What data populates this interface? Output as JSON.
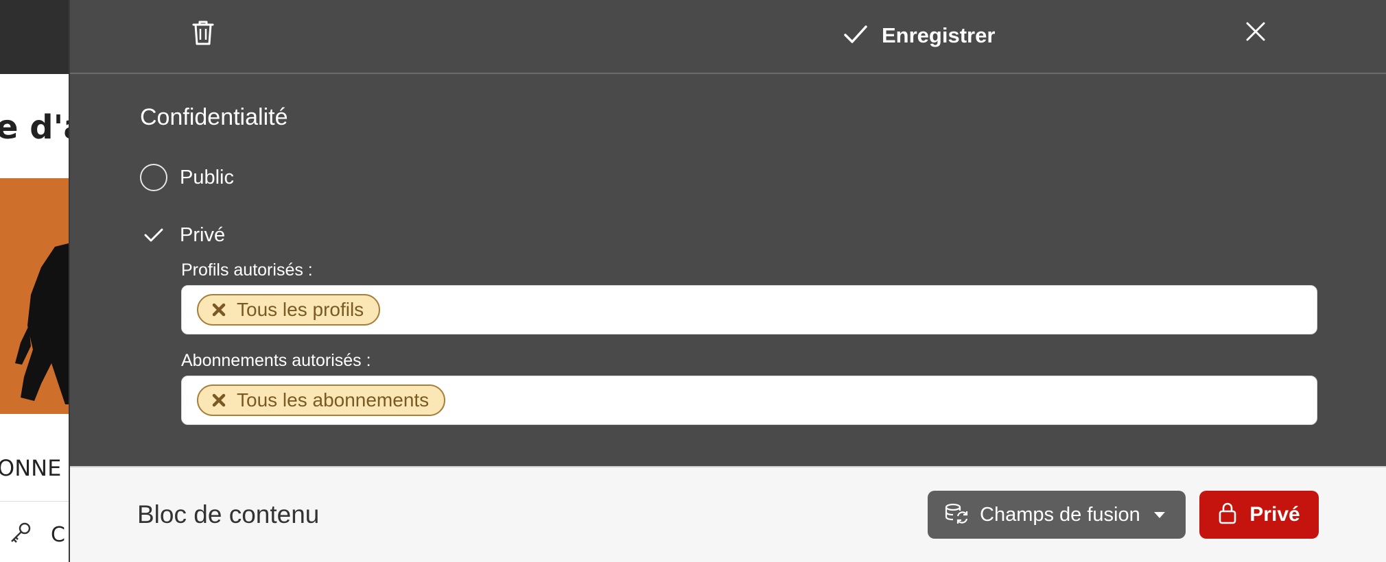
{
  "background": {
    "title_fragment": "e d'a",
    "caption_fragment": "ONNE",
    "menu_fragment": "C"
  },
  "toolbar": {
    "save_label": "Enregistrer"
  },
  "privacy": {
    "title": "Confidentialité",
    "options": [
      {
        "label": "Public",
        "selected": false
      },
      {
        "label": "Privé",
        "selected": true
      }
    ],
    "profiles_label": "Profils autorisés :",
    "profiles_tags": [
      "Tous les profils"
    ],
    "subscriptions_label": "Abonnements autorisés :",
    "subscriptions_tags": [
      "Tous les abonnements"
    ]
  },
  "bottom": {
    "block_title": "Bloc de contenu",
    "fusion_label": "Champs de fusion",
    "privacy_button_label": "Privé"
  },
  "colors": {
    "editor_bg": "#4a4a4a",
    "tag_bg": "#fbe7b6",
    "tag_border": "#a77f3a",
    "prive_button": "#c4140d",
    "fusion_button": "#5e5e5e",
    "bg_image": "#cf6f2c"
  },
  "icons": {
    "toolbar": [
      "trash-icon",
      "check-icon",
      "close-icon"
    ],
    "fusion": "database-sync-icon",
    "prive": "lock-icon",
    "menu": "key-icon"
  }
}
